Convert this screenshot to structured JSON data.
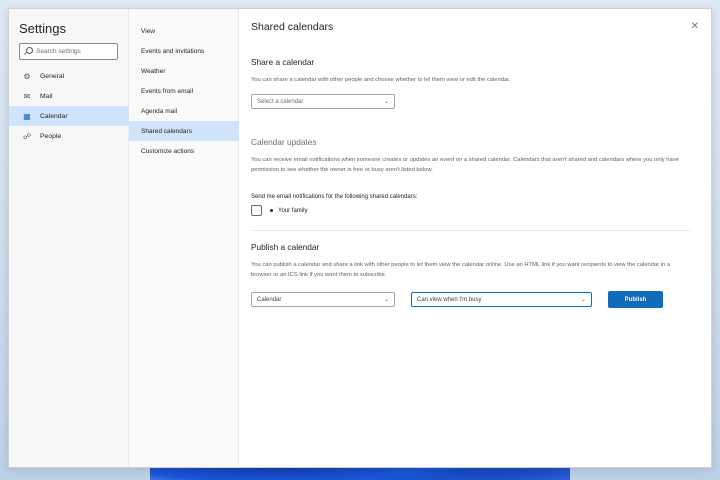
{
  "settings": {
    "title": "Settings",
    "search_placeholder": "Search settings"
  },
  "nav_primary": [
    {
      "label": "General",
      "icon": "gear-icon"
    },
    {
      "label": "Mail",
      "icon": "mail-icon"
    },
    {
      "label": "Calendar",
      "icon": "calendar-icon",
      "active": true
    },
    {
      "label": "People",
      "icon": "people-icon"
    }
  ],
  "nav_secondary": [
    {
      "label": "View"
    },
    {
      "label": "Events and invitations"
    },
    {
      "label": "Weather"
    },
    {
      "label": "Events from email"
    },
    {
      "label": "Agenda mail"
    },
    {
      "label": "Shared calendars",
      "active": true
    },
    {
      "label": "Customize actions"
    }
  ],
  "page": {
    "title": "Shared calendars"
  },
  "share": {
    "heading": "Share a calendar",
    "description": "You can share a calendar with other people and choose whether to let them view or edit the calendar.",
    "select_placeholder": "Select a calendar"
  },
  "updates": {
    "heading": "Calendar updates",
    "description": "You can receive email notifications when someone creates or updates an event on a shared calendar. Calendars that aren't shared and calendars where you only have permission to see whether the owner is free or busy aren't listed below.",
    "send_label": "Send me email notifications for the following shared calendars:",
    "calendar_item": "Your family"
  },
  "publish": {
    "heading": "Publish a calendar",
    "description": "You can publish a calendar and share a link with other people to let them view the calendar online. Use an HTML link if you want recipients to view the calendar in a browser or an ICS link if you want them to subscribe.",
    "calendar_select": "Calendar",
    "permission_select": "Can view when I'm busy",
    "button_label": "Publish"
  },
  "colors": {
    "accent": "#0f6cbd",
    "selected_bg": "#cfe4fa"
  }
}
